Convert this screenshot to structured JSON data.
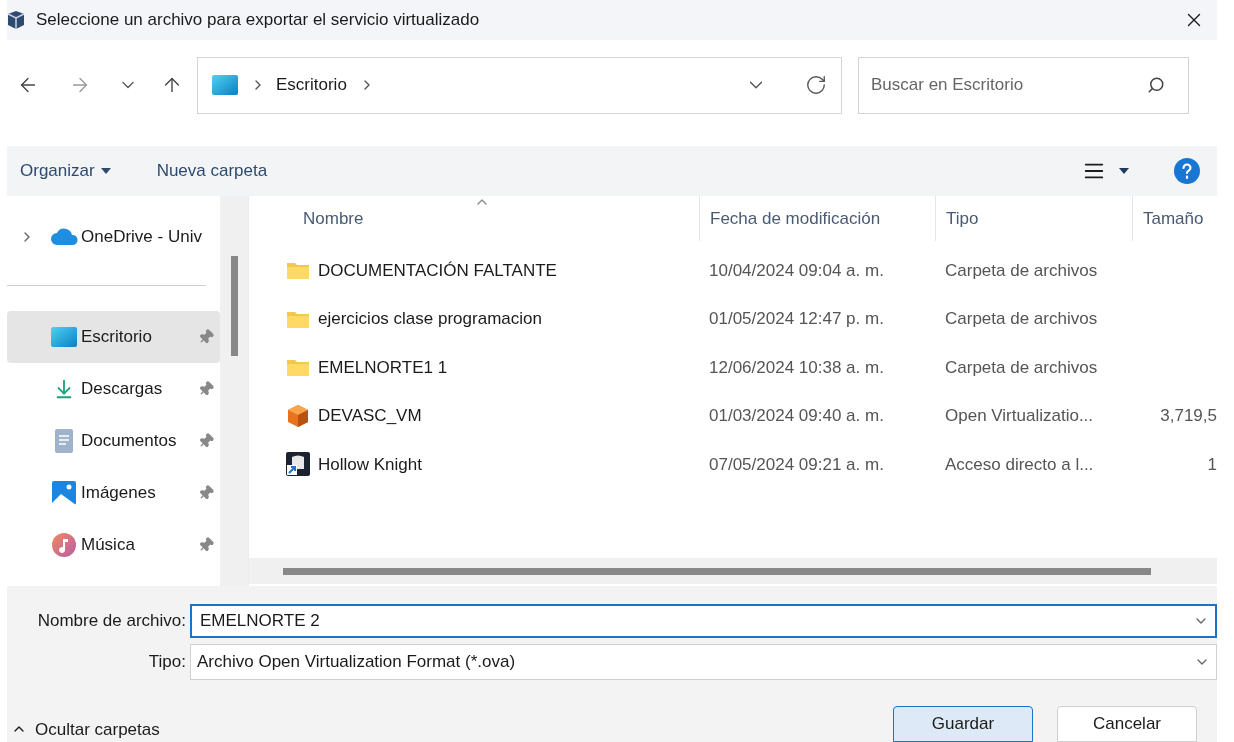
{
  "window": {
    "title": "Seleccione un archivo para exportar el servicio virtualizado"
  },
  "address": {
    "path": [
      "Escritorio"
    ]
  },
  "search": {
    "placeholder": "Buscar en Escritorio"
  },
  "toolbar": {
    "organize": "Organizar",
    "new_folder": "Nueva carpeta"
  },
  "sidebar": {
    "items": [
      {
        "label": "OneDrive - Univ",
        "kind": "onedrive",
        "selected": false,
        "pinned": false,
        "expandable": true
      },
      {
        "label": "Escritorio",
        "kind": "desktop",
        "selected": true,
        "pinned": true,
        "expandable": false
      },
      {
        "label": "Descargas",
        "kind": "downloads",
        "selected": false,
        "pinned": true,
        "expandable": false
      },
      {
        "label": "Documentos",
        "kind": "documents",
        "selected": false,
        "pinned": true,
        "expandable": false
      },
      {
        "label": "Imágenes",
        "kind": "pictures",
        "selected": false,
        "pinned": true,
        "expandable": false
      },
      {
        "label": "Música",
        "kind": "music",
        "selected": false,
        "pinned": true,
        "expandable": false
      }
    ]
  },
  "table": {
    "columns": [
      {
        "label": "Nombre",
        "sorted": true
      },
      {
        "label": "Fecha de modificación",
        "sorted": false
      },
      {
        "label": "Tipo",
        "sorted": false
      },
      {
        "label": "Tamaño",
        "sorted": false
      }
    ],
    "rows": [
      {
        "name": "DOCUMENTACIÓN FALTANTE",
        "kind": "folder",
        "date": "10/04/2024 09:04 a. m.",
        "type": "Carpeta de archivos",
        "size": ""
      },
      {
        "name": "ejercicios clase programacion",
        "kind": "folder",
        "date": "01/05/2024 12:47 p. m.",
        "type": "Carpeta de archivos",
        "size": ""
      },
      {
        "name": "EMELNORTE1 1",
        "kind": "folder",
        "date": "12/06/2024 10:38 a. m.",
        "type": "Carpeta de archivos",
        "size": ""
      },
      {
        "name": "DEVASC_VM",
        "kind": "vm",
        "date": "01/03/2024 09:40 a. m.",
        "type": "Open Virtualizatio...",
        "size": "3,719,5"
      },
      {
        "name": "Hollow Knight",
        "kind": "shortcut",
        "date": "07/05/2024 09:21 a. m.",
        "type": "Acceso directo a l...",
        "size": "1"
      }
    ]
  },
  "file_name": {
    "label": "Nombre de archivo:",
    "value": "EMELNORTE 2"
  },
  "file_type": {
    "label": "Tipo:",
    "value": "Archivo Open Virtualization Format (*.ova)"
  },
  "hide_folders": "Ocultar carpetas",
  "buttons": [
    {
      "label": "Guardar",
      "primary": true
    },
    {
      "label": "Cancelar",
      "primary": false
    }
  ]
}
